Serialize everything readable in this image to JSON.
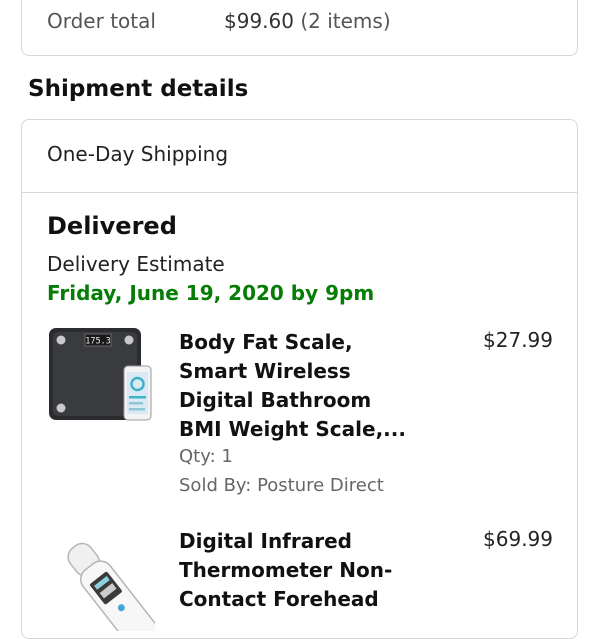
{
  "order_summary": {
    "total_label": "Order total",
    "total_value": "$99.60",
    "item_count": "(2 items)"
  },
  "shipment": {
    "section_title": "Shipment details",
    "method": "One-Day Shipping",
    "status": "Delivered",
    "estimate_label": "Delivery Estimate",
    "estimate_date": "Friday, June 19, 2020 by 9pm",
    "items": [
      {
        "title": "Body Fat Scale, Smart Wireless Digital Bathroom BMI Weight Scale,...",
        "price": "$27.99",
        "qty": "Qty: 1",
        "seller": "Sold By: Posture Direct",
        "scale_display": "175.3"
      },
      {
        "title": "Digital Infrared Thermometer Non-Contact Forehead",
        "price": "$69.99"
      }
    ]
  },
  "colors": {
    "delivery_green": "#067d06",
    "border": "#d5d9d9"
  }
}
